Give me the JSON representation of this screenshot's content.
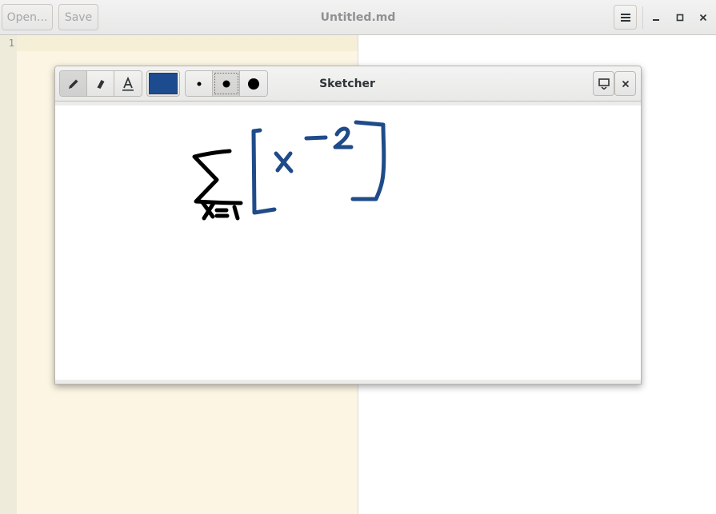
{
  "window": {
    "title": "Untitled.md",
    "open_label": "Open...",
    "save_label": "Save",
    "menu_icon": "hamburger-menu-icon",
    "minimize_icon": "minimize-icon",
    "maximize_icon": "maximize-icon",
    "close_icon": "close-icon"
  },
  "editor": {
    "line_numbers": [
      "1"
    ],
    "text": "",
    "background": "#fcf5e3",
    "gutter_background": "#eeebdb"
  },
  "sketcher": {
    "title": "Sketcher",
    "tools": [
      {
        "name": "pencil-icon",
        "active": true
      },
      {
        "name": "eraser-icon",
        "active": false
      },
      {
        "name": "text-tool-icon",
        "active": false
      }
    ],
    "current_color": "#1d4b8f",
    "sizes": [
      {
        "name": "small-dot-icon",
        "active": false
      },
      {
        "name": "medium-dot-icon",
        "active": true
      },
      {
        "name": "large-dot-icon",
        "active": false
      }
    ],
    "insert_icon": "insert-to-document-icon",
    "close_icon": "close-icon",
    "stroke_colors": {
      "black": "#000000",
      "blue": "#1f4b8a"
    }
  }
}
